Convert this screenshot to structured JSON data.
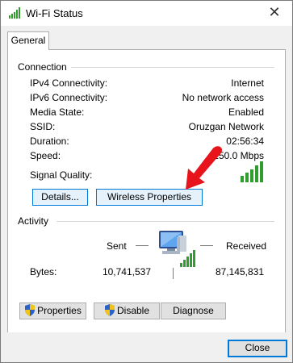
{
  "window": {
    "title": "Wi-Fi Status",
    "close_glyph": "✕"
  },
  "tabs": [
    {
      "label": "General"
    }
  ],
  "connection": {
    "heading": "Connection",
    "rows": [
      {
        "label": "IPv4 Connectivity:",
        "value": "Internet"
      },
      {
        "label": "IPv6 Connectivity:",
        "value": "No network access"
      },
      {
        "label": "Media State:",
        "value": "Enabled"
      },
      {
        "label": "SSID:",
        "value": "Oruzgan Network"
      },
      {
        "label": "Duration:",
        "value": "02:56:34"
      },
      {
        "label": "Speed:",
        "value": "150.0 Mbps"
      }
    ],
    "signal_label": "Signal Quality:",
    "signal_bars_lit": 5,
    "details_button": "Details...",
    "wireless_properties_button": "Wireless Properties"
  },
  "activity": {
    "heading": "Activity",
    "sent_label": "Sent",
    "received_label": "Received",
    "bytes_label": "Bytes:",
    "bytes_sent": "10,741,537",
    "bytes_received": "87,145,831"
  },
  "buttons": {
    "properties": "Properties",
    "disable": "Disable",
    "diagnose": "Diagnose",
    "close": "Close"
  },
  "colors": {
    "signal_green": "#2f9e2f",
    "focus_blue": "#0078d7",
    "arrow_red": "#e8141b"
  },
  "icons": [
    "wifi-signal-icon",
    "shield-icon",
    "network-computer-icon",
    "red-arrow-annotation"
  ]
}
